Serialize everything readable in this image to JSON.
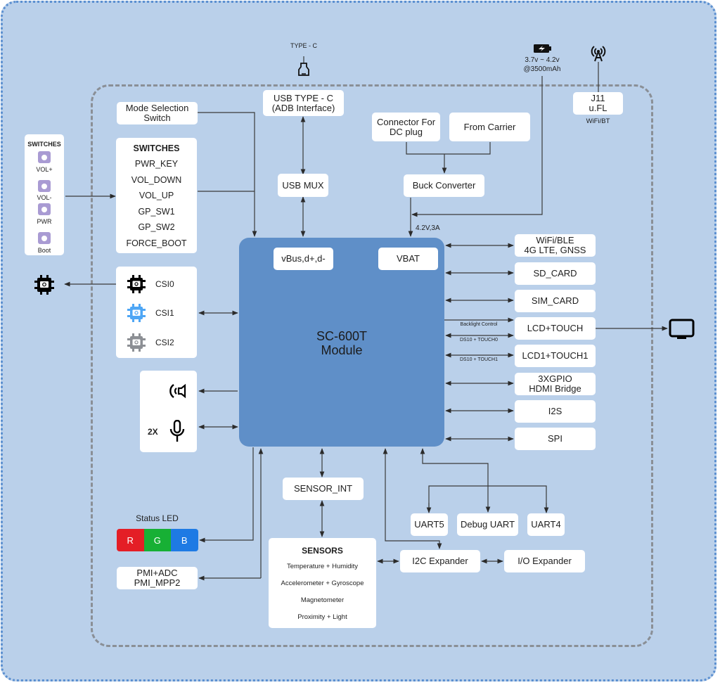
{
  "diagram": {
    "module": {
      "title_line1": "SC-600T",
      "title_line2": "Module",
      "port_usb": "vBus,d+,d-",
      "port_vbat": "VBAT"
    },
    "external": {
      "type_c_label": "TYPE - C",
      "battery_line1": "3.7v ~ 4.2v",
      "battery_line2": "@3500mAh",
      "antenna_caption": "WiFi/BT"
    },
    "left_panel_switches": {
      "title": "SWITCHES",
      "buttons": [
        "VOL+",
        "VOL-",
        "PWR",
        "Boot"
      ]
    },
    "boxes": {
      "mode_switch": [
        "Mode Selection",
        "Switch"
      ],
      "usb_typec": [
        "USB TYPE - C",
        "(ADB Interface)"
      ],
      "usb_mux": "USB MUX",
      "dc_connector": [
        "Connector For",
        "DC plug"
      ],
      "from_carrier": "From Carrier",
      "buck": "Buck Converter",
      "j11": [
        "J11",
        "u.FL"
      ],
      "sensor_int": "SENSOR_INT",
      "uart5": "UART5",
      "debug_uart": "Debug UART",
      "uart4": "UART4",
      "i2c_expander": "I2C Expander",
      "io_expander": "I/O Expander",
      "pmi": [
        "PMI+ADC",
        "PMI_MPP2"
      ]
    },
    "switches": {
      "title": "SWITCHES",
      "items": [
        "PWR_KEY",
        "VOL_DOWN",
        "VOL_UP",
        "GP_SW1",
        "GP_SW2",
        "FORCE_BOOT"
      ]
    },
    "cameras": [
      {
        "label": "CSI0",
        "color": "#000000"
      },
      {
        "label": "CSI1",
        "color": "#4ea6f5"
      },
      {
        "label": "CSI2",
        "color": "#8c8f94"
      }
    ],
    "audio": {
      "mic_count": "2X"
    },
    "right_peripherals": [
      [
        "WiFi/BLE",
        "4G LTE, GNSS"
      ],
      [
        "SD_CARD"
      ],
      [
        "SIM_CARD"
      ],
      [
        "LCD+TOUCH"
      ],
      [
        "LCD1+TOUCH1"
      ],
      [
        "3XGPIO",
        "HDMI Bridge"
      ],
      [
        "I2S"
      ],
      [
        "SPI"
      ]
    ],
    "wire_labels": {
      "power": "4.2V,3A",
      "backlight": "Backlight Control",
      "dsi0": "DS10 + TOUCH0",
      "dsi1": "DS10 + TOUCH1"
    },
    "status_led": {
      "title": "Status LED",
      "segments": [
        {
          "label": "R",
          "color": "#e41e26"
        },
        {
          "label": "G",
          "color": "#17b035"
        },
        {
          "label": "B",
          "color": "#1e7ae4"
        }
      ]
    },
    "sensors": {
      "title": "SENSORS",
      "items": [
        "Temperature + Humidity",
        "Accelerometer + Gyroscope",
        "Magnetometer",
        "Proximity + Light"
      ]
    },
    "colors": {
      "background": "#bad0ea",
      "module": "#5f8fc8",
      "outer_border": "#5b8fd0",
      "inner_border": "#8a8f96",
      "wire": "#2b2b2b"
    }
  }
}
